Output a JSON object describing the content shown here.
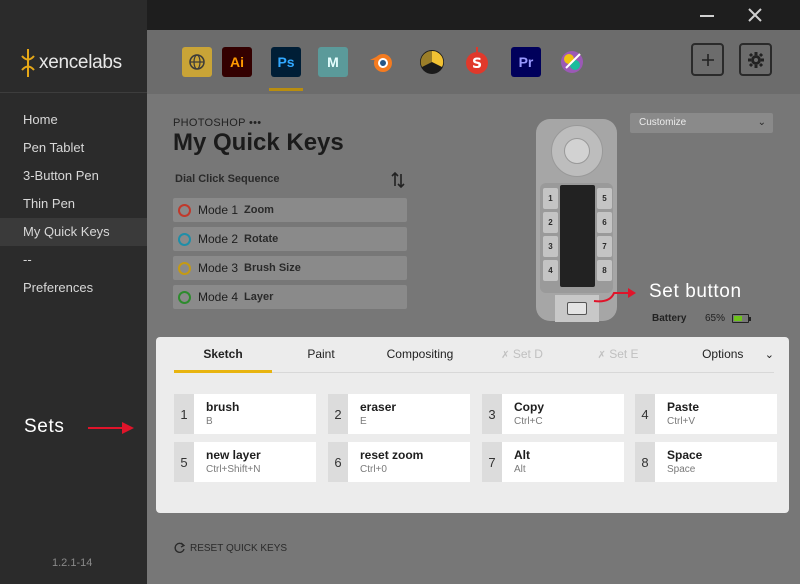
{
  "brand": {
    "name": "xencelabs"
  },
  "sidebar": {
    "items": [
      {
        "label": "Home"
      },
      {
        "label": "Pen Tablet"
      },
      {
        "label": "3-Button Pen"
      },
      {
        "label": "Thin Pen"
      },
      {
        "label": "My Quick Keys",
        "active": true
      },
      {
        "label": "--"
      },
      {
        "label": "Preferences"
      }
    ],
    "version": "1.2.1-14"
  },
  "window_controls": {
    "minimize_icon": "minimize-icon",
    "close_icon": "close-icon"
  },
  "apps": [
    {
      "name": "globe",
      "label": "",
      "bg": "#c9a437",
      "fg": "#3a3a3a"
    },
    {
      "name": "illustrator",
      "label": "Ai",
      "bg": "#330000",
      "fg": "#ff9a00"
    },
    {
      "name": "photoshop",
      "label": "Ps",
      "bg": "#001e36",
      "fg": "#31a8ff",
      "active": true
    },
    {
      "name": "maya",
      "label": "M",
      "bg": "#5b9a9a",
      "fg": "#e6ffff"
    },
    {
      "name": "blender",
      "label": "",
      "bg": "#f47b20",
      "fg": "#ffffff"
    },
    {
      "name": "nuke",
      "label": "",
      "bg": "#f2c233",
      "fg": "#1a1a1a"
    },
    {
      "name": "substance",
      "label": "S",
      "bg": "#e0392b",
      "fg": "#ffffff"
    },
    {
      "name": "premiere",
      "label": "Pr",
      "bg": "#00005b",
      "fg": "#9999ff"
    },
    {
      "name": "krita",
      "label": "",
      "bg": "#6a3aa8",
      "fg": "#ffffff"
    }
  ],
  "header": {
    "app_label": "PHOTOSHOP •••",
    "title": "My Quick Keys",
    "add_icon": "plus-icon",
    "settings_icon": "gear-icon"
  },
  "dial": {
    "label": "Dial Click Sequence",
    "modes": [
      {
        "name": "Mode 1",
        "function": "Zoom",
        "color": "#c0392b"
      },
      {
        "name": "Mode 2",
        "function": "Rotate",
        "color": "#1f8ea8"
      },
      {
        "name": "Mode 3",
        "function": "Brush Size",
        "color": "#c49a14"
      },
      {
        "name": "Mode 4",
        "function": "Layer",
        "color": "#2e8b2e"
      }
    ]
  },
  "customize": {
    "label": "Customize"
  },
  "device": {
    "left_keys": [
      "1",
      "2",
      "3",
      "4"
    ],
    "right_keys": [
      "5",
      "6",
      "7",
      "8"
    ]
  },
  "battery": {
    "label": "Battery",
    "value": "65%",
    "level": 0.65,
    "color": "#6ec31b"
  },
  "annotations": {
    "set_button": "Set button",
    "sets": "Sets",
    "arrow_color": "#e0142a"
  },
  "sets_panel": {
    "tabs": [
      {
        "label": "Sketch",
        "active": true
      },
      {
        "label": "Paint"
      },
      {
        "label": "Compositing"
      },
      {
        "label": "Set D",
        "disabled": true
      },
      {
        "label": "Set E",
        "disabled": true
      }
    ],
    "options_label": "Options",
    "keys": [
      {
        "num": "1",
        "name": "brush",
        "shortcut": "B"
      },
      {
        "num": "2",
        "name": "eraser",
        "shortcut": "E"
      },
      {
        "num": "3",
        "name": "Copy",
        "shortcut": "Ctrl+C"
      },
      {
        "num": "4",
        "name": "Paste",
        "shortcut": "Ctrl+V"
      },
      {
        "num": "5",
        "name": "new layer",
        "shortcut": "Ctrl+Shift+N"
      },
      {
        "num": "6",
        "name": "reset zoom",
        "shortcut": "Ctrl+0"
      },
      {
        "num": "7",
        "name": "Alt",
        "shortcut": "Alt"
      },
      {
        "num": "8",
        "name": "Space",
        "shortcut": "Space"
      }
    ]
  },
  "reset": {
    "label": "RESET QUICK KEYS"
  }
}
